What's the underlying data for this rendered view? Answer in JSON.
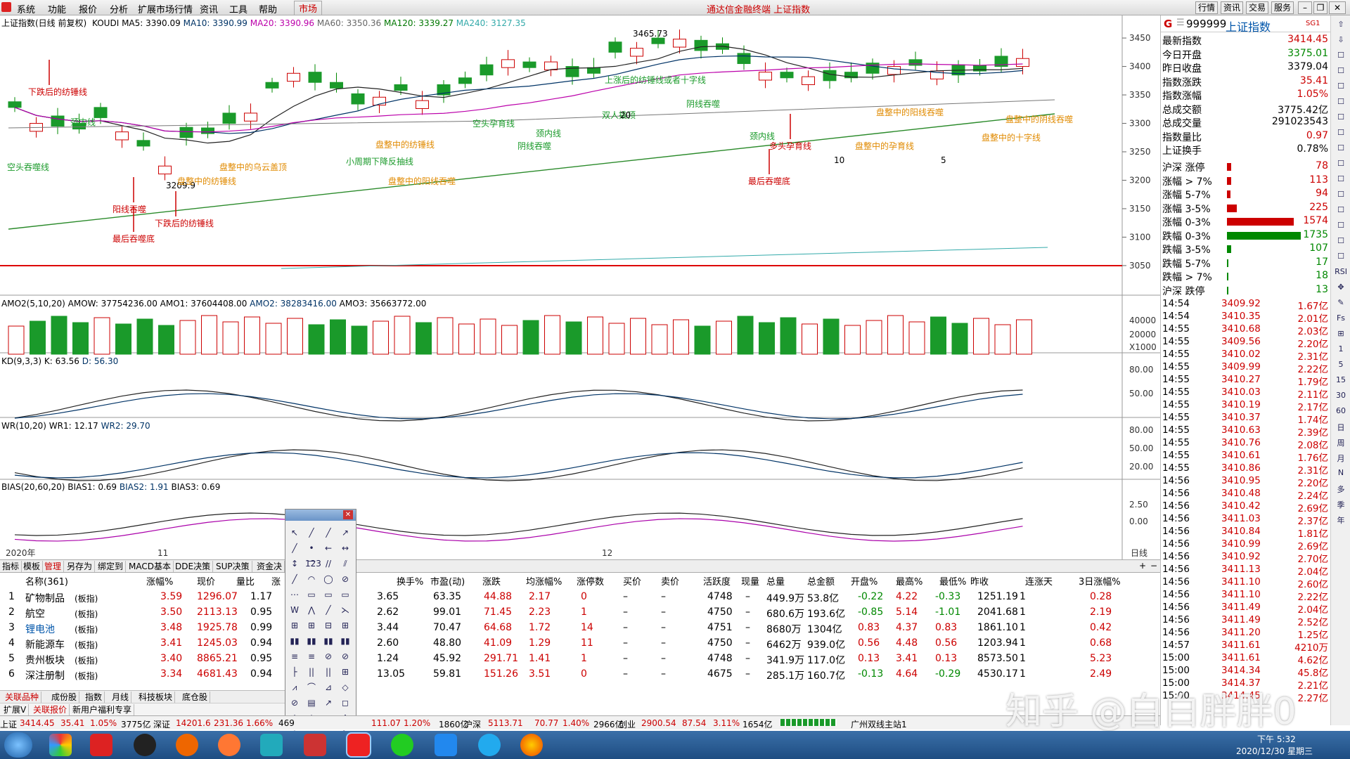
{
  "menu": [
    "系统",
    "功能",
    "报价",
    "分析",
    "扩展市场行情",
    "资讯",
    "工具",
    "帮助"
  ],
  "menu_active": "市场",
  "window_title": "通达信金融终端 上证指数",
  "top_buttons": [
    "行情",
    "资讯",
    "交易",
    "服务"
  ],
  "main_panel": {
    "title": "上证指数(日线 前复权)",
    "koudi": "KOUDI",
    "ma5": "MA5: 3390.09",
    "ma10": "MA10: 3390.99",
    "ma20": "MA20: 3390.96",
    "ma60": "MA60: 3350.36",
    "ma120": "MA120: 3339.27",
    "ma240": "MA240: 3127.35",
    "high_label": "3465.73",
    "low_label": "3209.9",
    "yaxis": [
      "3450",
      "3400",
      "3350",
      "3300",
      "3250",
      "3200",
      "3150",
      "3100",
      "3050"
    ],
    "annotations_red": [
      "下跌后的纺锤线",
      "阳线吞噬",
      "最后吞噬底",
      "下跌后的纺锤线",
      "多头孕育线",
      "最后吞噬底"
    ],
    "annotations_green": [
      "空头吞噬线",
      "颈内线",
      "小周期下降反抽线",
      "空头孕育线",
      "颈内线",
      "阴线吞噬",
      "双人撬顶",
      "上涨后的纺锤线或者十字线",
      "阴线吞噬",
      "颈内线"
    ],
    "annotations_orange": [
      "盘整中的纺锤线",
      "盘整中的乌云盖顶",
      "盘整中的纺锤线",
      "盘整中的阳线吞噬",
      "盘整中的孕育线",
      "盘整中的阳线吞噬",
      "盘整中的阴线吞噬",
      "盘整中的十字线"
    ],
    "nums": [
      "10",
      "5",
      "20"
    ]
  },
  "amo_panel": {
    "title": "AMO2(5,10,20)",
    "amow": "AMOW: 37754236.00",
    "amo1": "AMO1: 37604408.00",
    "amo2": "AMO2: 38283416.00",
    "amo3": "AMO3: 35663772.00",
    "yaxis": [
      "40000",
      "20000",
      "X1000"
    ]
  },
  "kd_panel": {
    "title": "KD(9,3,3)",
    "k": "K: 63.56",
    "d": "D: 56.30",
    "yaxis": [
      "80.00",
      "50.00"
    ]
  },
  "wr_panel": {
    "title": "WR(10,20)",
    "wr1": "WR1: 12.17",
    "wr2": "WR2: 29.70",
    "yaxis": [
      "80.00",
      "50.00",
      "20.00"
    ]
  },
  "bias_panel": {
    "title": "BIAS(20,60,20)",
    "b1": "BIAS1: 0.69",
    "b2": "BIAS2: 1.91",
    "b3": "BIAS3: 0.69",
    "yaxis": [
      "2.50",
      "0.00"
    ]
  },
  "xaxis": {
    "year": "2020年",
    "m11": "11",
    "m12": "12",
    "period": "日线"
  },
  "right": {
    "code": "999999",
    "name": "上证指数",
    "tag": "SG1",
    "rows": [
      {
        "l": "最新指数",
        "v": "3414.45",
        "c": "#c00"
      },
      {
        "l": "今日开盘",
        "v": "3375.01",
        "c": "#080"
      },
      {
        "l": "昨日收盘",
        "v": "3379.04",
        "c": "#000"
      },
      {
        "l": "指数涨跌",
        "v": "35.41",
        "c": "#c00"
      },
      {
        "l": "指数涨幅",
        "v": "1.05%",
        "c": "#c00"
      },
      {
        "l": "总成交额",
        "v": "3775.42亿",
        "c": "#000"
      },
      {
        "l": "总成交量",
        "v": "291023543",
        "c": "#000"
      },
      {
        "l": "指数量比",
        "v": "0.97",
        "c": "#c00"
      },
      {
        "l": "上证换手",
        "v": "0.78%",
        "c": "#000"
      }
    ],
    "breadth": [
      {
        "l": "沪深 涨停",
        "v": "78",
        "c": "#c00",
        "w": 6
      },
      {
        "l": "涨幅 > 7%",
        "v": "113",
        "c": "#c00",
        "w": 6
      },
      {
        "l": "涨幅 5-7%",
        "v": "94",
        "c": "#c00",
        "w": 5
      },
      {
        "l": "涨幅 3-5%",
        "v": "225",
        "c": "#c00",
        "w": 14
      },
      {
        "l": "涨幅 0-3%",
        "v": "1574",
        "c": "#c00",
        "w": 95
      },
      {
        "l": "跌幅 0-3%",
        "v": "1735",
        "c": "#080",
        "w": 105
      },
      {
        "l": "跌幅 3-5%",
        "v": "107",
        "c": "#080",
        "w": 6
      },
      {
        "l": "跌幅 5-7%",
        "v": "17",
        "c": "#080",
        "w": 2
      },
      {
        "l": "跌幅 > 7%",
        "v": "18",
        "c": "#080",
        "w": 2
      },
      {
        "l": "沪深 跌停",
        "v": "13",
        "c": "#080",
        "w": 2
      }
    ],
    "ticks": [
      [
        "14:54",
        "3409.92",
        "1.67亿"
      ],
      [
        "14:54",
        "3410.35",
        "2.01亿"
      ],
      [
        "14:55",
        "3410.68",
        "2.03亿"
      ],
      [
        "14:55",
        "3409.56",
        "2.20亿"
      ],
      [
        "14:55",
        "3410.02",
        "2.31亿"
      ],
      [
        "14:55",
        "3409.99",
        "2.22亿"
      ],
      [
        "14:55",
        "3410.27",
        "1.79亿"
      ],
      [
        "14:55",
        "3410.03",
        "2.11亿"
      ],
      [
        "14:55",
        "3410.19",
        "2.17亿"
      ],
      [
        "14:55",
        "3410.37",
        "1.74亿"
      ],
      [
        "14:55",
        "3410.63",
        "2.39亿"
      ],
      [
        "14:55",
        "3410.76",
        "2.08亿"
      ],
      [
        "14:55",
        "3410.61",
        "1.76亿"
      ],
      [
        "14:55",
        "3410.86",
        "2.31亿"
      ],
      [
        "14:56",
        "3410.95",
        "2.20亿"
      ],
      [
        "14:56",
        "3410.48",
        "2.24亿"
      ],
      [
        "14:56",
        "3410.42",
        "2.69亿"
      ],
      [
        "14:56",
        "3411.03",
        "2.37亿"
      ],
      [
        "14:56",
        "3410.84",
        "1.81亿"
      ],
      [
        "14:56",
        "3410.99",
        "2.69亿"
      ],
      [
        "14:56",
        "3410.92",
        "2.70亿"
      ],
      [
        "14:56",
        "3411.13",
        "2.04亿"
      ],
      [
        "14:56",
        "3411.10",
        "2.60亿"
      ],
      [
        "14:56",
        "3411.10",
        "2.22亿"
      ],
      [
        "14:56",
        "3411.49",
        "2.04亿"
      ],
      [
        "14:56",
        "3411.49",
        "2.52亿"
      ],
      [
        "14:56",
        "3411.20",
        "1.25亿"
      ],
      [
        "14:57",
        "3411.61",
        "4210万"
      ],
      [
        "15:00",
        "3411.61",
        "4.62亿"
      ],
      [
        "15:00",
        "3414.34",
        "45.8亿"
      ],
      [
        "15:00",
        "3414.37",
        "2.21亿"
      ],
      [
        "15:00",
        "3414.45",
        "2.27亿"
      ]
    ]
  },
  "tabs": [
    "指标",
    "模板",
    "管理",
    "另存为",
    "绑定到",
    "MACD基本",
    "DDE决策",
    "SUP决策",
    "资金决"
  ],
  "table": {
    "headers": [
      "",
      "名称(361)",
      "涨幅%",
      "现价",
      "量比",
      "涨",
      "换手%",
      "市盈(动)",
      "涨跌",
      "均涨幅%",
      "涨停数",
      "买价",
      "卖价",
      "活跃度",
      "现量",
      "总量",
      "总金额",
      "开盘%",
      "最高%",
      "最低%",
      "昨收",
      "连涨天",
      "3日涨幅%"
    ],
    "rows": [
      [
        "1",
        "矿物制品",
        "(板指)",
        "3.59",
        "1296.07",
        "1.17",
        "0",
        "3.65",
        "63.35",
        "44.88",
        "2.17",
        "0",
        "–",
        "–",
        "4748",
        "–",
        "449.9万",
        "53.8亿",
        "-0.22",
        "4.22",
        "-0.33",
        "1251.19",
        "1",
        "0.28"
      ],
      [
        "2",
        "航空",
        "(板指)",
        "3.50",
        "2113.13",
        "0.95",
        "0",
        "2.62",
        "99.01",
        "71.45",
        "2.23",
        "1",
        "–",
        "–",
        "4750",
        "–",
        "680.6万",
        "193.6亿",
        "-0.85",
        "5.14",
        "-1.01",
        "2041.68",
        "1",
        "2.19"
      ],
      [
        "3",
        "锂电池",
        "(板指)",
        "3.48",
        "1925.78",
        "0.99",
        "0",
        "3.44",
        "70.47",
        "64.68",
        "1.72",
        "14",
        "–",
        "–",
        "4751",
        "–",
        "8680万",
        "1304亿",
        "0.83",
        "4.37",
        "0.83",
        "1861.10",
        "1",
        "0.42"
      ],
      [
        "4",
        "新能源车",
        "(板指)",
        "3.41",
        "1245.03",
        "0.94",
        "0",
        "2.60",
        "48.80",
        "41.09",
        "1.29",
        "11",
        "–",
        "–",
        "4750",
        "–",
        "6462万",
        "939.0亿",
        "0.56",
        "4.48",
        "0.56",
        "1203.94",
        "1",
        "0.68"
      ],
      [
        "5",
        "贵州板块",
        "(板指)",
        "3.40",
        "8865.21",
        "0.95",
        "0",
        "1.24",
        "45.92",
        "291.71",
        "1.41",
        "1",
        "–",
        "–",
        "4748",
        "–",
        "341.9万",
        "117.0亿",
        "0.13",
        "3.41",
        "0.13",
        "8573.50",
        "1",
        "5.23"
      ],
      [
        "6",
        "深注册制",
        "(板指)",
        "3.34",
        "4681.43",
        "0.94",
        "-0",
        "13.05",
        "59.81",
        "151.26",
        "3.51",
        "0",
        "–",
        "–",
        "4675",
        "–",
        "285.1万",
        "160.7亿",
        "-0.13",
        "4.64",
        "-0.29",
        "4530.17",
        "1",
        "2.49"
      ]
    ]
  },
  "bottom_tabs": [
    "关联品种",
    "成份股",
    "指数",
    "月线",
    "科技板块",
    "底仓股"
  ],
  "bottom_tabs2": [
    "扩展V",
    "关联报价",
    "新用户福利专享"
  ],
  "status": [
    "上证",
    "3414.45",
    "35.41",
    "1.05%",
    "3775亿",
    "深证",
    "14201.6",
    "231.36",
    "1.66%",
    "469",
    "111.07",
    "1.20%",
    "1860亿",
    "沪深",
    "5113.71",
    "70.77",
    "1.40%",
    "2966亿",
    "创业",
    "2900.54",
    "87.54",
    "3.11%",
    "1654亿",
    "广州双线主站1"
  ],
  "watermark": "知乎 @白白胖胖0",
  "clock": {
    "time": "下午 5:32",
    "date": "2020/12/30 星期三"
  }
}
